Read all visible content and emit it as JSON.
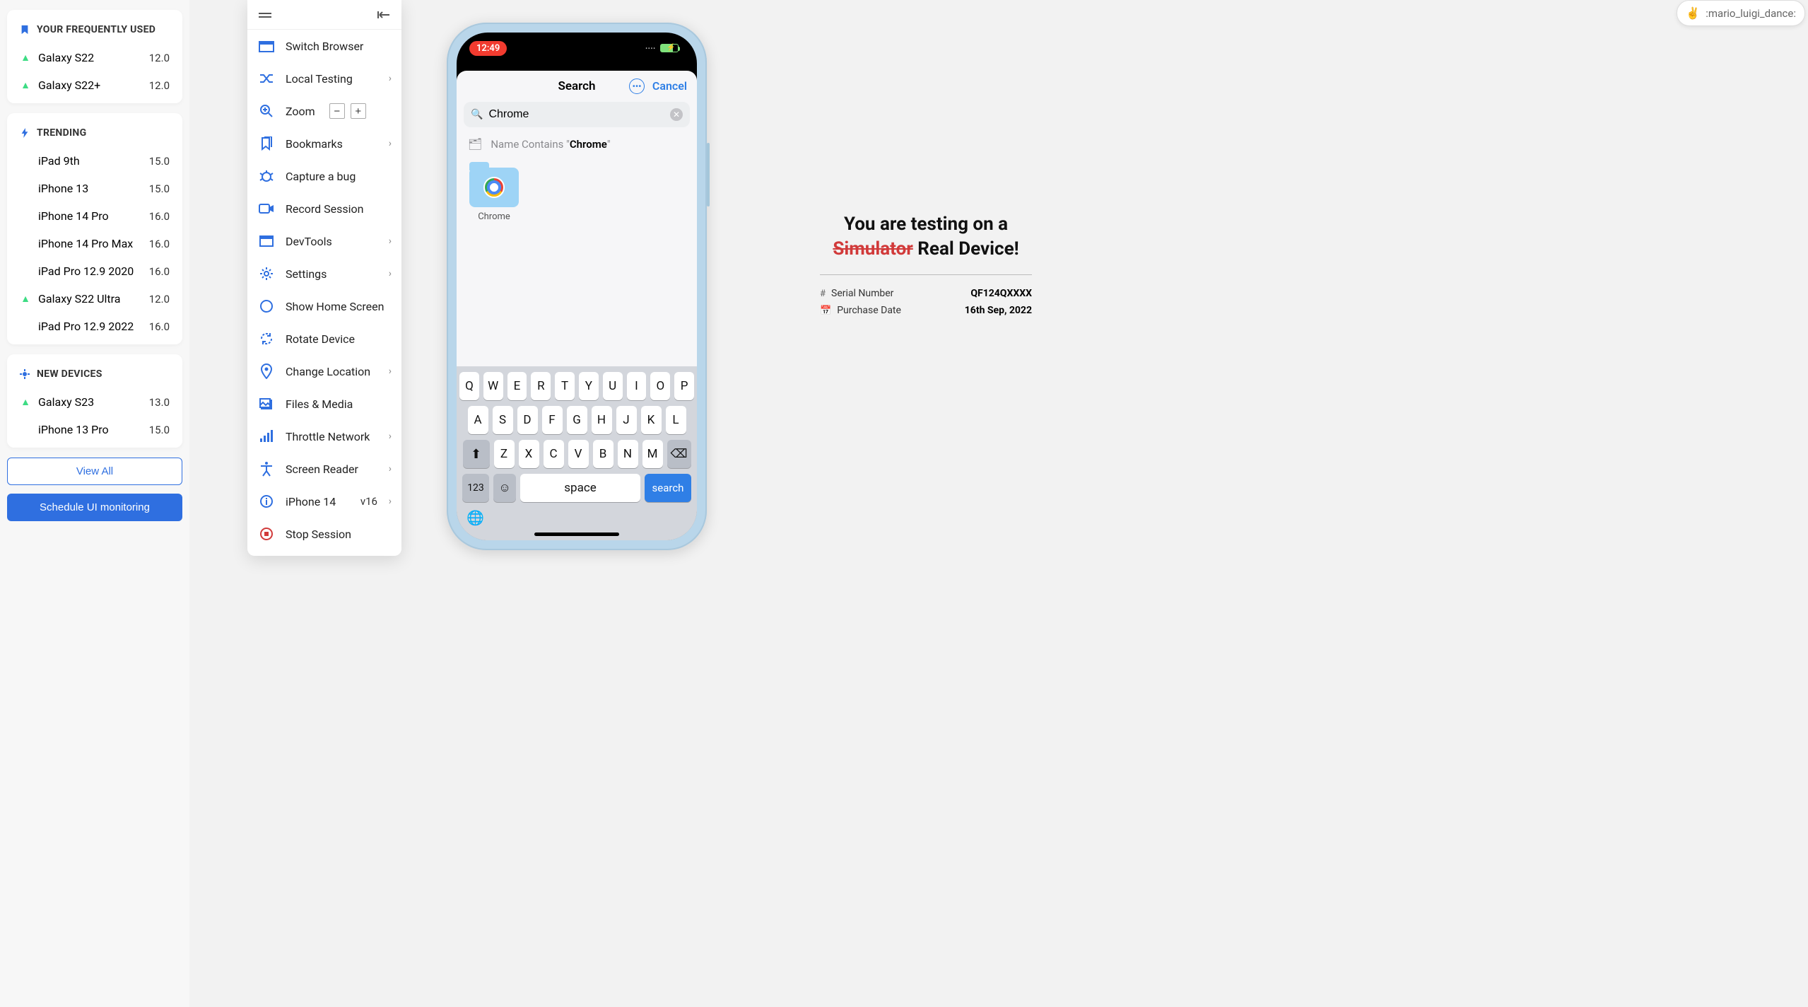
{
  "sidebar": {
    "sections": [
      {
        "title": "YOUR FREQUENTLY USED",
        "icon": "bookmark",
        "iconColor": "#2f6fe0",
        "items": [
          {
            "os": "android",
            "name": "Galaxy S22",
            "version": "12.0"
          },
          {
            "os": "android",
            "name": "Galaxy S22+",
            "version": "12.0"
          }
        ]
      },
      {
        "title": "TRENDING",
        "icon": "bolt",
        "iconColor": "#2f6fe0",
        "items": [
          {
            "os": "apple",
            "name": "iPad 9th",
            "version": "15.0"
          },
          {
            "os": "apple",
            "name": "iPhone 13",
            "version": "15.0"
          },
          {
            "os": "apple",
            "name": "iPhone 14 Pro",
            "version": "16.0"
          },
          {
            "os": "apple",
            "name": "iPhone 14 Pro Max",
            "version": "16.0"
          },
          {
            "os": "apple",
            "name": "iPad Pro 12.9 2020",
            "version": "16.0"
          },
          {
            "os": "android",
            "name": "Galaxy S22 Ultra",
            "version": "12.0"
          },
          {
            "os": "apple",
            "name": "iPad Pro 12.9 2022",
            "version": "16.0"
          }
        ]
      },
      {
        "title": "NEW DEVICES",
        "icon": "sparkle",
        "iconColor": "#2f6fe0",
        "items": [
          {
            "os": "android",
            "name": "Galaxy S23",
            "version": "13.0"
          },
          {
            "os": "apple",
            "name": "iPhone 13 Pro",
            "version": "15.0"
          }
        ]
      }
    ],
    "viewAll": "View All",
    "schedule": "Schedule UI monitoring"
  },
  "tools": {
    "switchBrowser": "Switch Browser",
    "localTesting": "Local Testing",
    "zoom": "Zoom",
    "bookmarks": "Bookmarks",
    "captureBug": "Capture a bug",
    "recordSession": "Record Session",
    "devtools": "DevTools",
    "settings": "Settings",
    "showHome": "Show Home Screen",
    "rotate": "Rotate Device",
    "changeLocation": "Change Location",
    "filesMedia": "Files & Media",
    "throttle": "Throttle Network",
    "screenReader": "Screen Reader",
    "deviceName": "iPhone 14",
    "deviceVersion": "v16",
    "stop": "Stop Session"
  },
  "phone": {
    "time": "12:49",
    "sheetTitle": "Search",
    "cancel": "Cancel",
    "searchValue": "Chrome",
    "filterPrefix": "Name Contains \"",
    "filterTerm": "Chrome",
    "filterSuffix": "\"",
    "resultLabel": "Chrome",
    "keyboard": {
      "row1": [
        "Q",
        "W",
        "E",
        "R",
        "T",
        "Y",
        "U",
        "I",
        "O",
        "P"
      ],
      "row2": [
        "A",
        "S",
        "D",
        "F",
        "G",
        "H",
        "J",
        "K",
        "L"
      ],
      "row3": [
        "Z",
        "X",
        "C",
        "V",
        "B",
        "N",
        "M"
      ],
      "numKey": "123",
      "space": "space",
      "search": "search"
    }
  },
  "info": {
    "headingPrefix": "You are testing on a",
    "headingStrike": "Simulator",
    "headingSuffix": "Real Device!",
    "rows": [
      {
        "icon": "#",
        "label": "Serial Number",
        "value": "QF124QXXXX"
      },
      {
        "icon": "📅",
        "label": "Purchase Date",
        "value": "16th Sep, 2022"
      }
    ]
  },
  "topChip": {
    "emoji": "✌️",
    "text": ":mario_luigi_dance:"
  }
}
